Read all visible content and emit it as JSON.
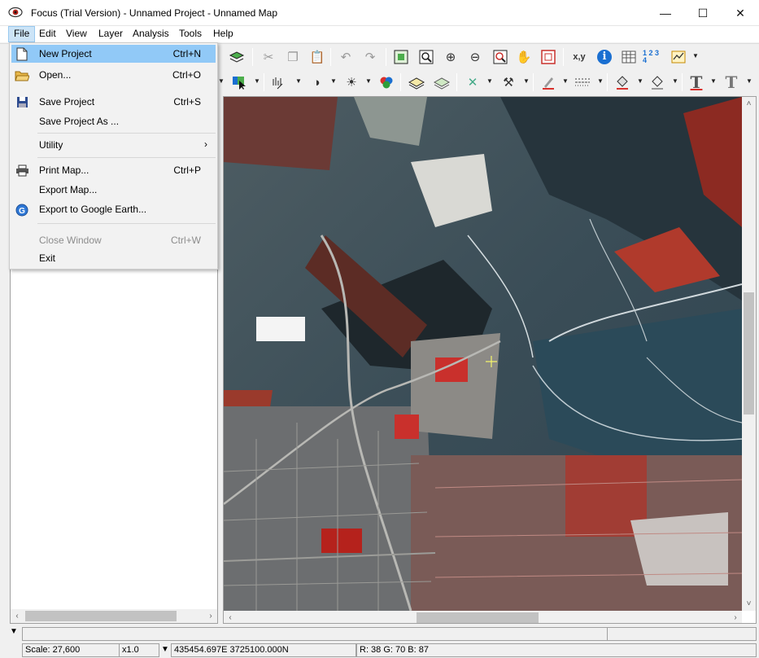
{
  "window": {
    "title": "Focus (Trial Version) - Unnamed Project - Unnamed Map",
    "minimize_glyph": "—",
    "maximize_glyph": "☐",
    "close_glyph": "✕"
  },
  "menubar": {
    "items": [
      "File",
      "Edit",
      "View",
      "Layer",
      "Analysis",
      "Tools",
      "Help"
    ],
    "active": "File"
  },
  "file_menu": {
    "items": [
      {
        "label": "New Project",
        "shortcut": "Ctrl+N",
        "icon": "new-document-icon",
        "highlighted": true
      },
      {
        "label": "Open...",
        "shortcut": "Ctrl+O",
        "icon": "open-folder-icon"
      },
      {
        "label": "Save Project",
        "shortcut": "Ctrl+S",
        "icon": "save-disk-icon"
      },
      {
        "label": "Save Project As ...",
        "shortcut": ""
      },
      {
        "label": "Utility",
        "submenu_glyph": "›"
      },
      {
        "label": "Print Map...",
        "shortcut": "Ctrl+P",
        "icon": "printer-icon"
      },
      {
        "label": "Export Map...",
        "shortcut": ""
      },
      {
        "label": "Export to Google Earth...",
        "shortcut": "",
        "icon": "google-earth-icon"
      },
      {
        "label": "Close Window",
        "shortcut": "Ctrl+W",
        "disabled": true
      },
      {
        "label": "Exit",
        "shortcut": ""
      }
    ]
  },
  "toolbar": {
    "coordinates_label": "x,y",
    "info_label": "i",
    "numbers_label": "1 2 3 4",
    "text_tool_label": "T"
  },
  "scroll": {
    "left": "‹",
    "right": "›",
    "up": "˄",
    "down": "˅"
  },
  "status": {
    "scale": "Scale: 27,600",
    "zoom": "x1.0",
    "coordinates": "435454.697E 3725100.000N",
    "pixel_value": "R: 38 G: 70 B: 87",
    "expander_glyph": "▼"
  },
  "colors": {
    "menu_highlight": "#91c9f7",
    "menu_active_bg": "#cce4f7",
    "info_blue": "#1a6fd1",
    "cursor_yellow": "#f4f46b"
  }
}
